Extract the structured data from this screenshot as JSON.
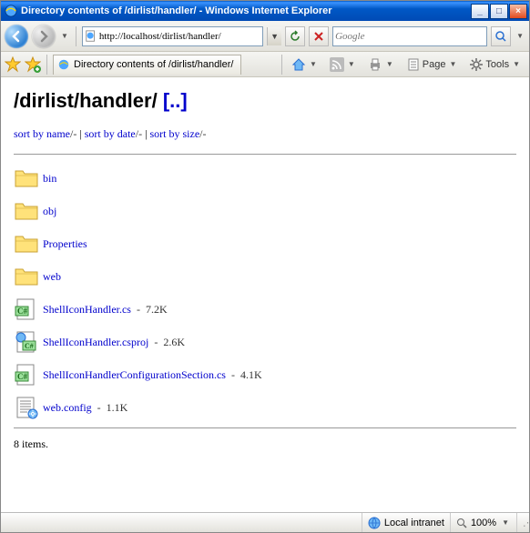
{
  "window": {
    "title": "Directory contents of /dirlist/handler/ - Windows Internet Explorer"
  },
  "address": {
    "url": "http://localhost/dirlist/handler/"
  },
  "search": {
    "placeholder": "Google"
  },
  "tab": {
    "title": "Directory contents of /dirlist/handler/"
  },
  "tools": {
    "page_label": "Page",
    "tools_label": "Tools"
  },
  "page": {
    "heading_path": "/dirlist/handler/",
    "heading_parent": "[..]",
    "sort": {
      "by_name": "sort by name",
      "by_date": "sort by date",
      "by_size": "sort by size",
      "suffix": "/-",
      "pipe": " | "
    },
    "entries": [
      {
        "type": "folder",
        "name": "bin",
        "size": ""
      },
      {
        "type": "folder",
        "name": "obj",
        "size": ""
      },
      {
        "type": "folder",
        "name": "Properties",
        "size": ""
      },
      {
        "type": "folder",
        "name": "web",
        "size": ""
      },
      {
        "type": "cs",
        "name": "ShellIconHandler.cs",
        "size": "7.2K"
      },
      {
        "type": "csproj",
        "name": "ShellIconHandler.csproj",
        "size": "2.6K"
      },
      {
        "type": "cs",
        "name": "ShellIconHandlerConfigurationSection.cs",
        "size": "4.1K"
      },
      {
        "type": "config",
        "name": "web.config",
        "size": "1.1K"
      }
    ],
    "count_text": "8 items."
  },
  "status": {
    "zone": "Local intranet",
    "zoom": "100%"
  }
}
